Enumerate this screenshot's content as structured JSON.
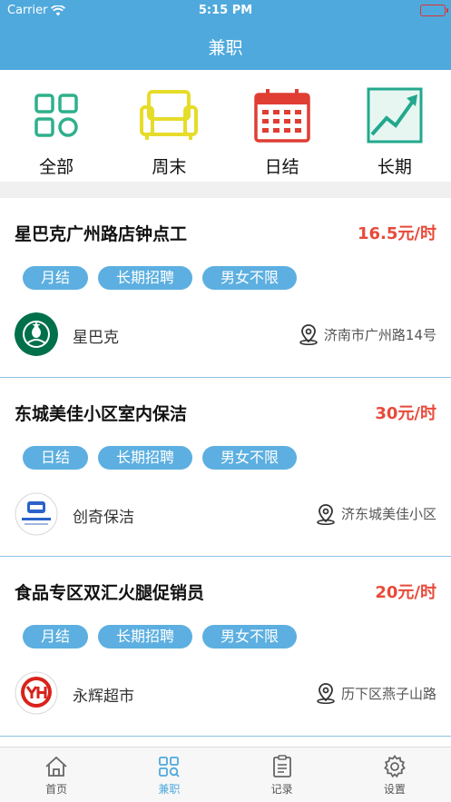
{
  "status": {
    "carrier": "Carrier",
    "time": "5:15 PM"
  },
  "nav": {
    "title": "兼职"
  },
  "categories": [
    {
      "label": "全部",
      "icon": "grid-icon",
      "color": "#2fb08c"
    },
    {
      "label": "周末",
      "icon": "sofa-icon",
      "color": "#e6dc2a"
    },
    {
      "label": "日结",
      "icon": "calendar-icon",
      "color": "#e03d33"
    },
    {
      "label": "长期",
      "icon": "trend-chart-icon",
      "color": "#22a88d"
    }
  ],
  "jobs": [
    {
      "title": "星巴克广州路店钟点工",
      "salary": "16.5元/时",
      "tags": [
        "月结",
        "长期招聘",
        "男女不限"
      ],
      "company": "星巴克",
      "address": "济南市广州路14号",
      "logo": "starbucks-logo"
    },
    {
      "title": "东城美佳小区室内保洁",
      "salary": "30元/时",
      "tags": [
        "日结",
        "长期招聘",
        "男女不限"
      ],
      "company": "创奇保洁",
      "address": "济东城美佳小区",
      "logo": "chuangqi-logo"
    },
    {
      "title": "食品专区双汇火腿促销员",
      "salary": "20元/时",
      "tags": [
        "月结",
        "长期招聘",
        "男女不限"
      ],
      "company": "永辉超市",
      "address": "历下区燕子山路",
      "logo": "yonghui-logo"
    }
  ],
  "tabbar": [
    {
      "label": "首页",
      "icon": "home-icon",
      "active": false
    },
    {
      "label": "兼职",
      "icon": "search-grid-icon",
      "active": true
    },
    {
      "label": "记录",
      "icon": "clipboard-icon",
      "active": false
    },
    {
      "label": "设置",
      "icon": "gear-icon",
      "active": false
    }
  ],
  "colors": {
    "primary": "#4fa9dc",
    "salary": "#e84a3a",
    "tag": "#5cafe0"
  }
}
